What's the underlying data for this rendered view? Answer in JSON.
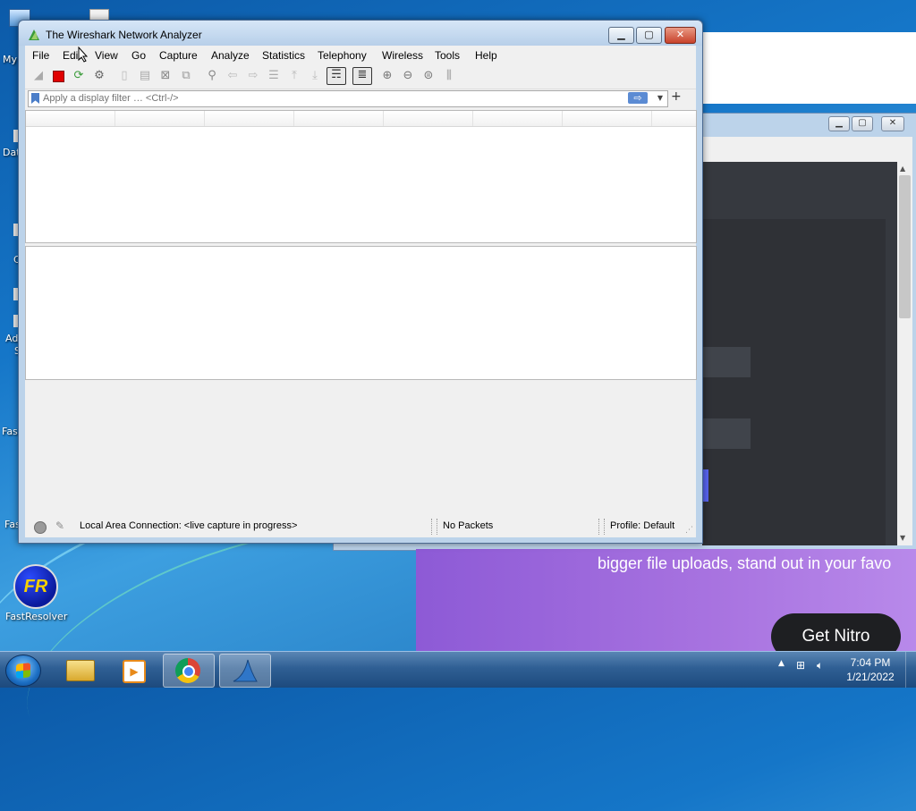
{
  "desktop": {
    "icons": [
      {
        "label": "My"
      },
      {
        "label": "Dat"
      },
      {
        "label": "C"
      },
      {
        "label": "Ad"
      },
      {
        "label": "S"
      },
      {
        "label": "Fast"
      },
      {
        "label": "Fast"
      }
    ],
    "fastresolver": {
      "badge": "FR",
      "label": "FastResolver"
    }
  },
  "background_app": {
    "banner_text": "bigger file uploads, stand out in your favo",
    "cta_label": "Get Nitro"
  },
  "wireshark": {
    "title": "The Wireshark Network Analyzer",
    "menu": [
      "File",
      "Edit",
      "View",
      "Go",
      "Capture",
      "Analyze",
      "Statistics",
      "Telephony",
      "Wireless",
      "Tools",
      "Help"
    ],
    "filter": {
      "placeholder": "Apply a display filter … <Ctrl-/>",
      "apply_glyph": "⇨",
      "add_glyph": "+"
    },
    "status": {
      "interface": "Local Area Connection: <live capture in progress>",
      "packets": "No Packets",
      "profile": "Profile: Default"
    }
  },
  "taskbar": {
    "clock_time": "7:04 PM",
    "clock_date": "1/21/2022"
  },
  "colors": {
    "wallpaper": "#1576c8",
    "window_frame": "#bcd3ea",
    "close_button": "#c8422b",
    "nitro_purple": "#a873e0",
    "capture_stop": "#e00000",
    "discord_dark": "#36393f"
  }
}
